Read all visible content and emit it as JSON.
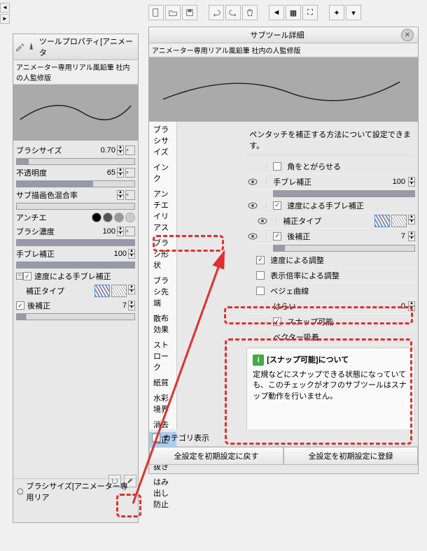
{
  "left_panel": {
    "header": "ツールプロパティ[アニメータ",
    "brush_title": "アニメーター専用リアル風鉛筆 社内の人監修版",
    "props": {
      "brush_size": {
        "label": "ブラシサイズ",
        "value": "0.70"
      },
      "opacity": {
        "label": "不透明度",
        "value": "65"
      },
      "sub_color": {
        "label": "サブ描画色混合率"
      },
      "antialias": {
        "label": "アンチエ"
      },
      "density": {
        "label": "ブラシ濃度",
        "value": "100"
      },
      "stabilization": {
        "label": "手ブレ補正",
        "value": "100"
      },
      "velocity_stab": {
        "label": "速度による手ブレ補正"
      },
      "correction_type": {
        "label": "補正タイプ"
      },
      "post_correct": {
        "label": "後補正",
        "value": "7"
      }
    },
    "footer_label": "ブラシサイズ[アニメーター専用リア"
  },
  "right_panel": {
    "header": "サブツール詳細",
    "brush_title": "アニメーター専用リアル風鉛筆 社内の人監修版",
    "categories": [
      "ブラシサイズ",
      "インク",
      "アンチエイリアス",
      "ブラシ形状",
      "ブラシ先端",
      "散布効果",
      "ストローク",
      "紙質",
      "水彩境界",
      "消去",
      "補正",
      "入り抜き",
      "はみ出し防止"
    ],
    "selected_category": "補正",
    "detail_desc": "ペンタッチを補正する方法について設定できます。",
    "rows": {
      "sharpen": {
        "label": "角をとがらせる"
      },
      "stabilization": {
        "label": "手ブレ補正",
        "value": "100"
      },
      "velocity_stab": {
        "label": "速度による手ブレ補正"
      },
      "correction_type": {
        "label": "補正タイプ"
      },
      "post_correct": {
        "label": "後補正",
        "value": "7"
      },
      "velocity_adjust": {
        "label": "速度による調整"
      },
      "zoom_adjust": {
        "label": "表示倍率による調整"
      },
      "bezier": {
        "label": "ベジェ曲線"
      },
      "taper": {
        "label": "はらい",
        "value": "0"
      },
      "snap": {
        "label": "スナップ可能"
      },
      "vector": {
        "label": "ベクター吸着"
      }
    },
    "info_title": "[スナップ可能]について",
    "info_text": "定規などにスナップできる状態になっていても、このチェックがオフのサブツールはスナップ動作を行いません。",
    "category_show": "カテゴリ表示",
    "btn_reset": "全設定を初期設定に戻す",
    "btn_save": "全設定を初期設定に登録"
  }
}
